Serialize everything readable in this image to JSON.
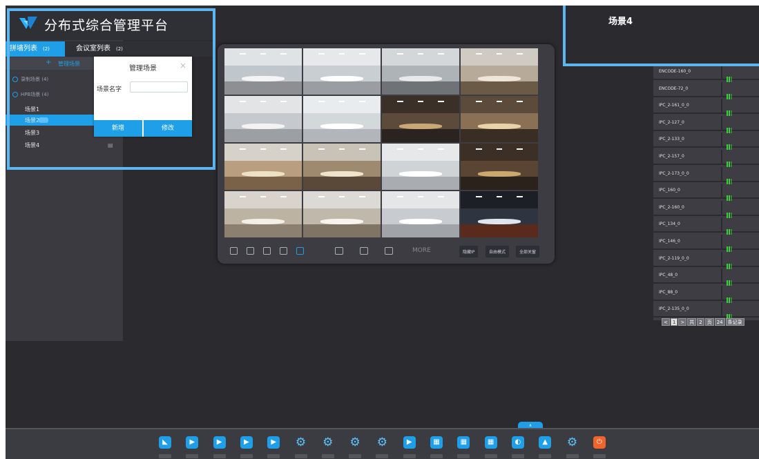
{
  "app": {
    "title": "分布式综合管理平台"
  },
  "tabs": [
    {
      "label": "拼墙列表",
      "count": "(2)"
    },
    {
      "label": "会议室列表",
      "count": "(2)"
    }
  ],
  "sidebar": {
    "manage_label": "管理场景",
    "groups": [
      {
        "label": "录制场景 (4)"
      },
      {
        "label": "HPB场景 (4)"
      }
    ],
    "scenes": [
      "场景1",
      "场景2",
      "场景3",
      "场景4"
    ]
  },
  "modal": {
    "title": "管理场景",
    "field_label": "场景名字",
    "field_value": "",
    "add_label": "新增",
    "edit_label": "修改",
    "close": "×"
  },
  "highlight": {
    "scene_name": "场景4"
  },
  "wall_toolbar": {
    "more": "MORE",
    "buttons": [
      "隐藏IP",
      "自由模式",
      "全部关窗"
    ]
  },
  "devices": [
    "ENCODE-160_0",
    "ENCODE-72_0",
    "IPC_2-161_0_0",
    "IPC_2-127_0",
    "IPC_2-133_0",
    "IPC_2-157_0",
    "IPC_2-173_0_0",
    "IPC_160_0",
    "IPC_2-160_0",
    "IPC_134_0",
    "IPC_146_0",
    "IPC_2-119_0_0",
    "IPC_48_0",
    "IPC_88_0",
    "IPC_2-135_0_0"
  ],
  "pager": {
    "prev": "<",
    "current": "1",
    "next": ">",
    "total_pages_prefix": "共",
    "total_pages": "2",
    "pages_unit": "页",
    "total_records": "24",
    "records_unit": "条记录"
  },
  "dock": {
    "tab_label": "∧",
    "items": [
      {
        "name": "app-logo-icon",
        "glyph": "◣"
      },
      {
        "name": "play-icon",
        "glyph": "▶"
      },
      {
        "name": "play-icon",
        "glyph": "▶"
      },
      {
        "name": "play-icon",
        "glyph": "▶"
      },
      {
        "name": "play-icon",
        "glyph": "▶"
      },
      {
        "name": "gear-icon",
        "glyph": "⚙"
      },
      {
        "name": "gear-icon",
        "glyph": "⚙"
      },
      {
        "name": "gear-icon",
        "glyph": "⚙"
      },
      {
        "name": "gear-icon",
        "glyph": "⚙"
      },
      {
        "name": "play-icon",
        "glyph": "▶"
      },
      {
        "name": "grid-icon",
        "glyph": "▦"
      },
      {
        "name": "grid-icon",
        "glyph": "▦"
      },
      {
        "name": "grid-icon",
        "glyph": "▦"
      },
      {
        "name": "globe-icon",
        "glyph": "◐"
      },
      {
        "name": "user-icon",
        "glyph": "▲"
      },
      {
        "name": "gear-icon",
        "glyph": "⚙"
      },
      {
        "name": "power-icon",
        "glyph": "⏻"
      }
    ]
  },
  "colors": {
    "accent": "#1f9fe8",
    "highlight_border": "#5db6f0",
    "bg": "#2a2a2f",
    "power": "#f2642b",
    "signal": "#3bd13b"
  }
}
